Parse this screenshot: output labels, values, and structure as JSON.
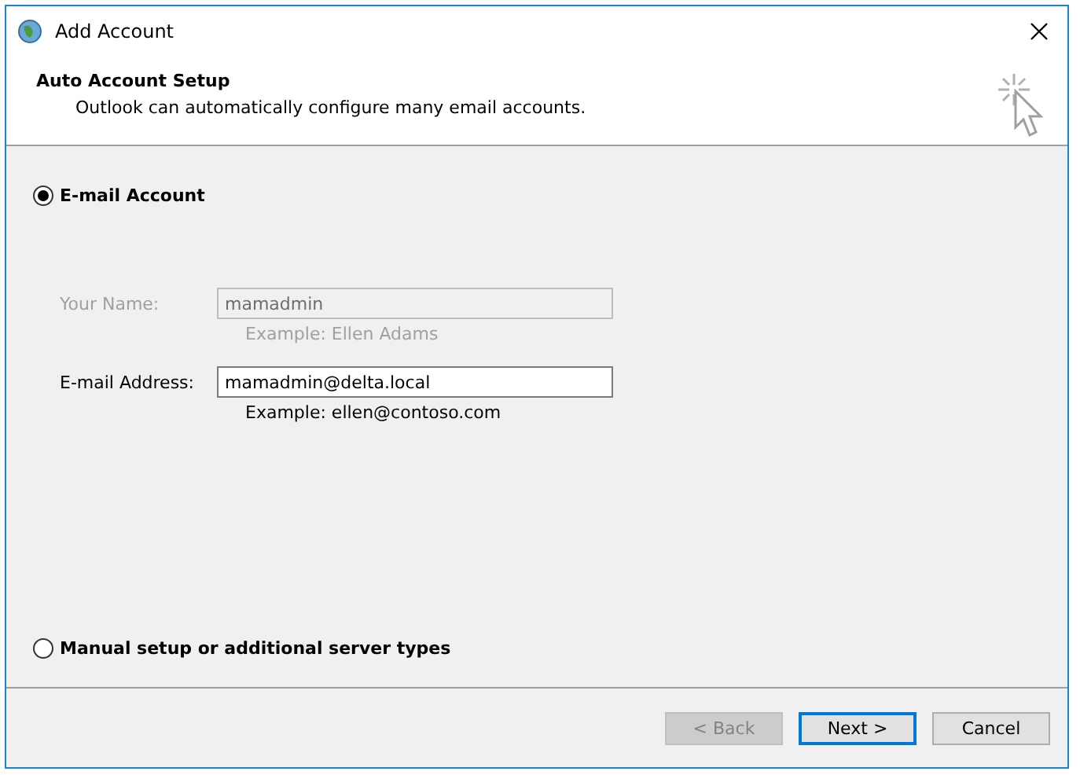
{
  "window": {
    "title": "Add Account"
  },
  "header": {
    "title": "Auto Account Setup",
    "subtitle": "Outlook can automatically configure many email accounts."
  },
  "options": [
    {
      "label": "E-mail Account",
      "selected": true
    },
    {
      "label": "Manual setup or additional server types",
      "selected": false
    }
  ],
  "fields": [
    {
      "label": "Your Name:",
      "value": "mamadmin",
      "example": "Example: Ellen Adams",
      "disabled": true
    },
    {
      "label": "E-mail Address:",
      "value": "mamadmin@delta.local",
      "example": "Example: ellen@contoso.com",
      "disabled": false
    }
  ],
  "buttons": [
    {
      "label": "< Back",
      "disabled": true,
      "focused": false
    },
    {
      "label": "Next >",
      "disabled": false,
      "focused": true
    },
    {
      "label": "Cancel",
      "disabled": false,
      "focused": false
    }
  ]
}
